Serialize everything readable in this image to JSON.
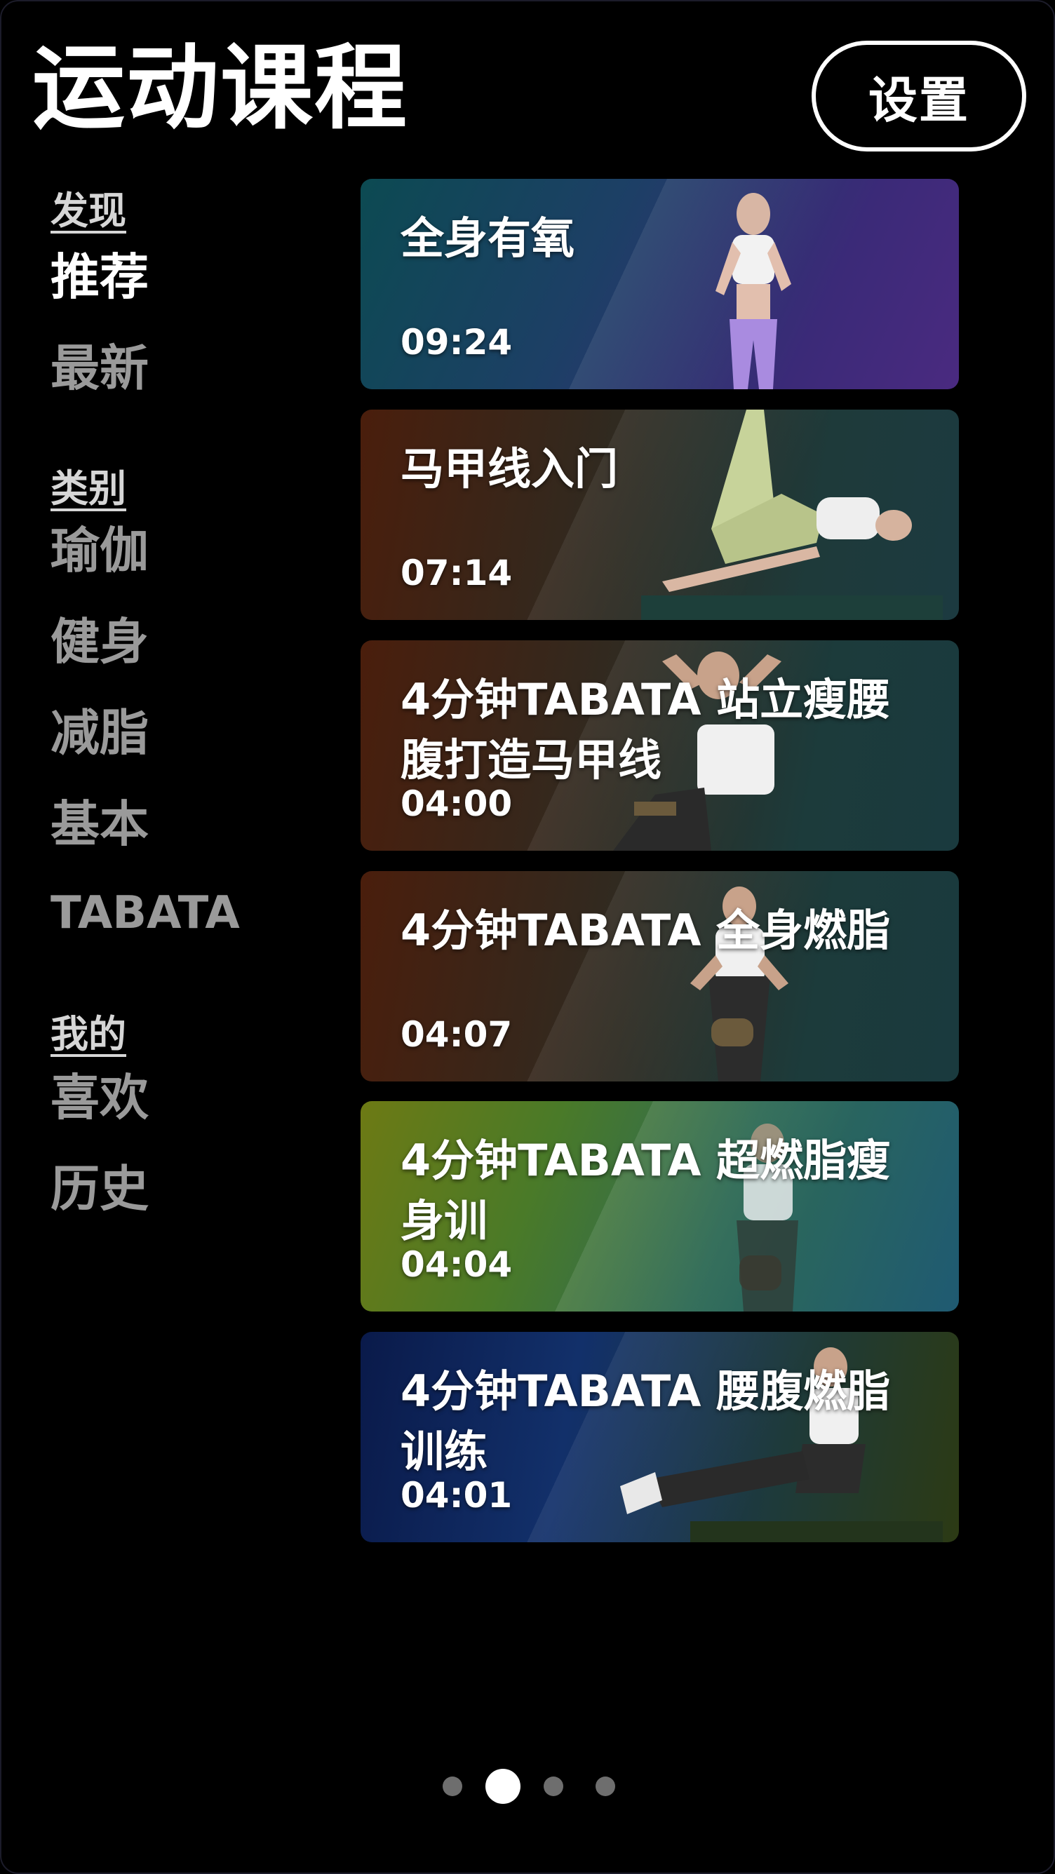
{
  "header": {
    "title": "运动课程",
    "settings_label": "设置"
  },
  "sidebar": {
    "sections": [
      {
        "heading": "发现",
        "items": [
          {
            "label": "推荐",
            "active": true
          },
          {
            "label": "最新",
            "active": false
          }
        ]
      },
      {
        "heading": "类别",
        "items": [
          {
            "label": "瑜伽",
            "active": false
          },
          {
            "label": "健身",
            "active": false
          },
          {
            "label": "减脂",
            "active": false
          },
          {
            "label": "基本",
            "active": false
          },
          {
            "label": "TABATA",
            "active": false
          }
        ]
      },
      {
        "heading": "我的",
        "items": [
          {
            "label": "喜欢",
            "active": false
          },
          {
            "label": "历史",
            "active": false
          }
        ]
      }
    ]
  },
  "courses": [
    {
      "title": "全身有氧",
      "duration": "09:24"
    },
    {
      "title": "马甲线入门",
      "duration": "07:14"
    },
    {
      "title": "4分钟TABATA 站立瘦腰腹打造马甲线",
      "duration": "04:00"
    },
    {
      "title": "4分钟TABATA  全身燃脂",
      "duration": "04:07"
    },
    {
      "title": "4分钟TABATA 超燃脂瘦身训",
      "duration": "04:04"
    },
    {
      "title": "4分钟TABATA 腰腹燃脂训练",
      "duration": "04:01"
    }
  ],
  "pager": {
    "count": 4,
    "active_index": 1
  },
  "colors": {
    "background": "#000000",
    "inactive_nav": "#9a9a9a",
    "active_nav": "#ffffff",
    "dot_inactive": "#6e6e6e",
    "dot_active": "#ffffff"
  }
}
